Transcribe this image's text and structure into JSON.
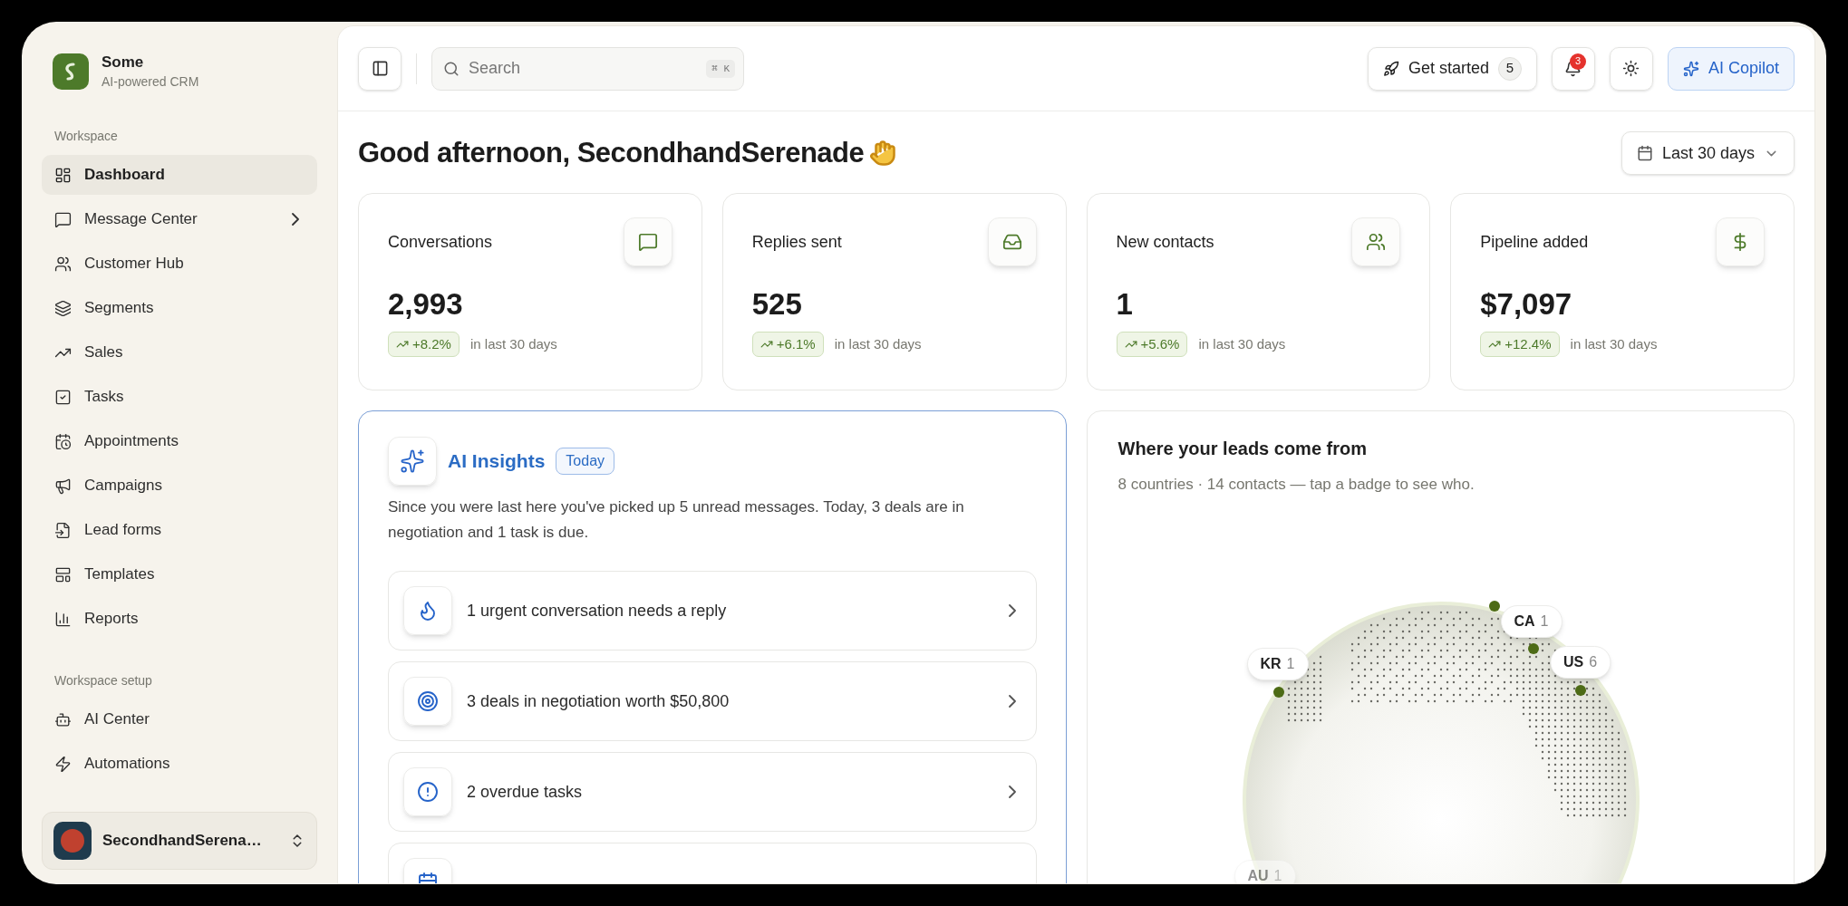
{
  "brand": {
    "name": "Some",
    "tagline": "AI-powered CRM"
  },
  "sidebar": {
    "sections": [
      {
        "title": "Workspace",
        "items": [
          {
            "label": "Dashboard",
            "kind": "dashboard",
            "selected": true,
            "expandable": false
          },
          {
            "label": "Message Center",
            "kind": "message",
            "selected": false,
            "expandable": true
          },
          {
            "label": "Customer Hub",
            "kind": "users",
            "selected": false,
            "expandable": false
          },
          {
            "label": "Segments",
            "kind": "layers",
            "selected": false,
            "expandable": false
          },
          {
            "label": "Sales",
            "kind": "trend",
            "selected": false,
            "expandable": false
          },
          {
            "label": "Tasks",
            "kind": "check",
            "selected": false,
            "expandable": false
          },
          {
            "label": "Appointments",
            "kind": "schedule",
            "selected": false,
            "expandable": false
          },
          {
            "label": "Campaigns",
            "kind": "megaphone",
            "selected": false,
            "expandable": false
          },
          {
            "label": "Lead forms",
            "kind": "form",
            "selected": false,
            "expandable": false
          },
          {
            "label": "Templates",
            "kind": "template",
            "selected": false,
            "expandable": false
          },
          {
            "label": "Reports",
            "kind": "chart",
            "selected": false,
            "expandable": false
          }
        ]
      },
      {
        "title": "Workspace setup",
        "items": [
          {
            "label": "AI Center",
            "kind": "bot",
            "selected": false,
            "expandable": false
          },
          {
            "label": "Automations",
            "kind": "zap",
            "selected": false,
            "expandable": false
          }
        ]
      }
    ]
  },
  "user": {
    "name": "SecondhandSerena…"
  },
  "topbar": {
    "search": {
      "placeholder": "Search",
      "shortcut": "⌘ K"
    },
    "get_started": {
      "label": "Get started",
      "count": "5"
    },
    "notifications": {
      "count": "3"
    },
    "copilot": {
      "label": "AI Copilot"
    }
  },
  "greeting": "Good afternoon, SecondhandSerenade",
  "date_range": "Last 30 days",
  "stats": [
    {
      "label": "Conversations",
      "kind": "message",
      "value": "2,993",
      "delta": "+8.2%",
      "note": "in last 30 days"
    },
    {
      "label": "Replies sent",
      "kind": "inbox",
      "value": "525",
      "delta": "+6.1%",
      "note": "in last 30 days"
    },
    {
      "label": "New contacts",
      "kind": "users",
      "value": "1",
      "delta": "+5.6%",
      "note": "in last 30 days"
    },
    {
      "label": "Pipeline added",
      "kind": "dollar",
      "value": "$7,097",
      "delta": "+12.4%",
      "note": "in last 30 days"
    }
  ],
  "insights": {
    "title": "AI Insights",
    "badge": "Today",
    "summary": "Since you were last here you've picked up 5 unread messages. Today, 3 deals are in negotiation and 1 task is due.",
    "items": [
      {
        "kind": "urgent",
        "text": "1 urgent conversation needs a reply"
      },
      {
        "kind": "deals",
        "text": "3 deals in negotiation worth $50,800"
      },
      {
        "kind": "overdue",
        "text": "2 overdue tasks"
      },
      {
        "kind": "schedule"
      }
    ]
  },
  "leads": {
    "title": "Where your leads come from",
    "subtitle": "8 countries · 14 contacts — tap a badge to see who.",
    "markers": [
      {
        "code": "KR",
        "count": "1",
        "faded": false
      },
      {
        "code": "CA",
        "count": "1",
        "faded": false
      },
      {
        "code": "US",
        "count": "6",
        "faded": false
      },
      {
        "code": "AU",
        "count": "1",
        "faded": true
      }
    ]
  }
}
